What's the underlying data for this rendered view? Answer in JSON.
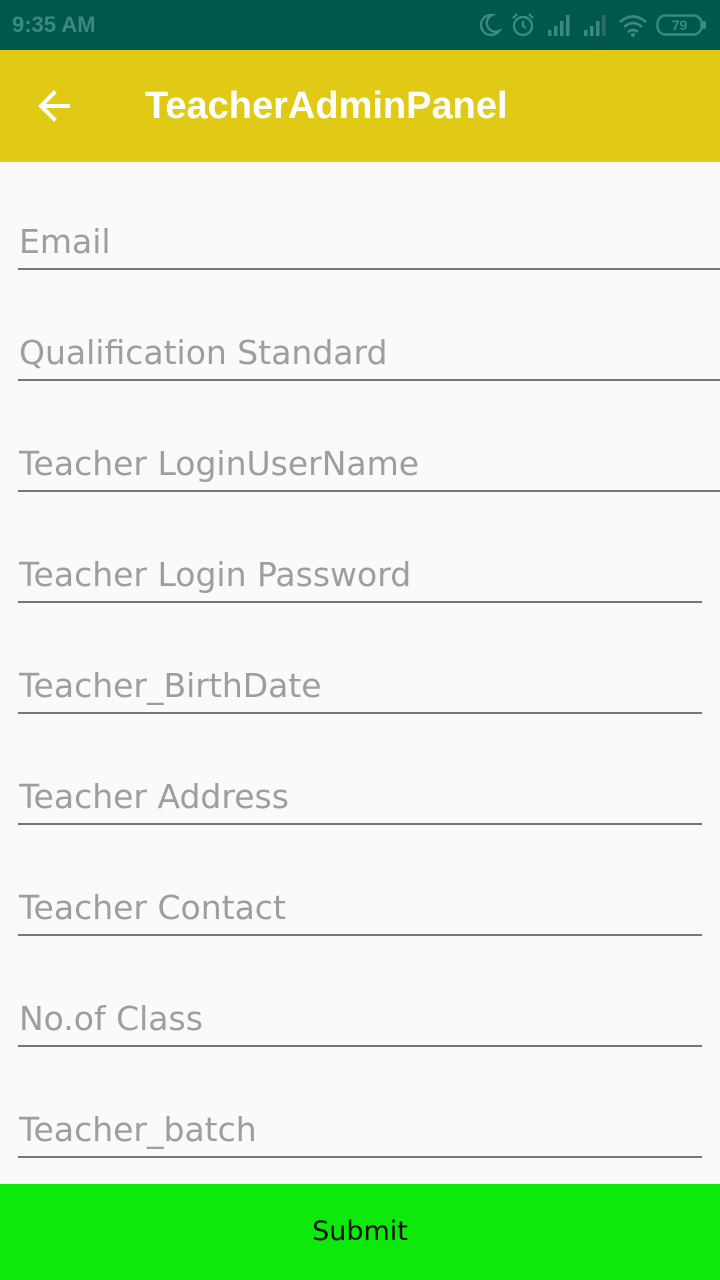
{
  "status_bar": {
    "time": "9:35 AM",
    "battery": "79"
  },
  "app_bar": {
    "title": "TeacherAdminPanel",
    "back_icon": "arrow-back-icon"
  },
  "form": {
    "fields": [
      {
        "placeholder": "Email",
        "value": ""
      },
      {
        "placeholder": "Qualification Standard",
        "value": ""
      },
      {
        "placeholder": "Teacher LoginUserName",
        "value": ""
      },
      {
        "placeholder": "Teacher Login Password",
        "value": ""
      },
      {
        "placeholder": "Teacher_BirthDate",
        "value": ""
      },
      {
        "placeholder": "Teacher Address",
        "value": ""
      },
      {
        "placeholder": "Teacher Contact",
        "value": ""
      },
      {
        "placeholder": "No.of Class",
        "value": ""
      },
      {
        "placeholder": "Teacher_batch",
        "value": ""
      }
    ]
  },
  "submit": {
    "label": "Submit"
  },
  "colors": {
    "status_bar": "#00574b",
    "app_bar": "#e0ca15",
    "submit_button": "#0ce90b",
    "background": "#fafafa"
  }
}
